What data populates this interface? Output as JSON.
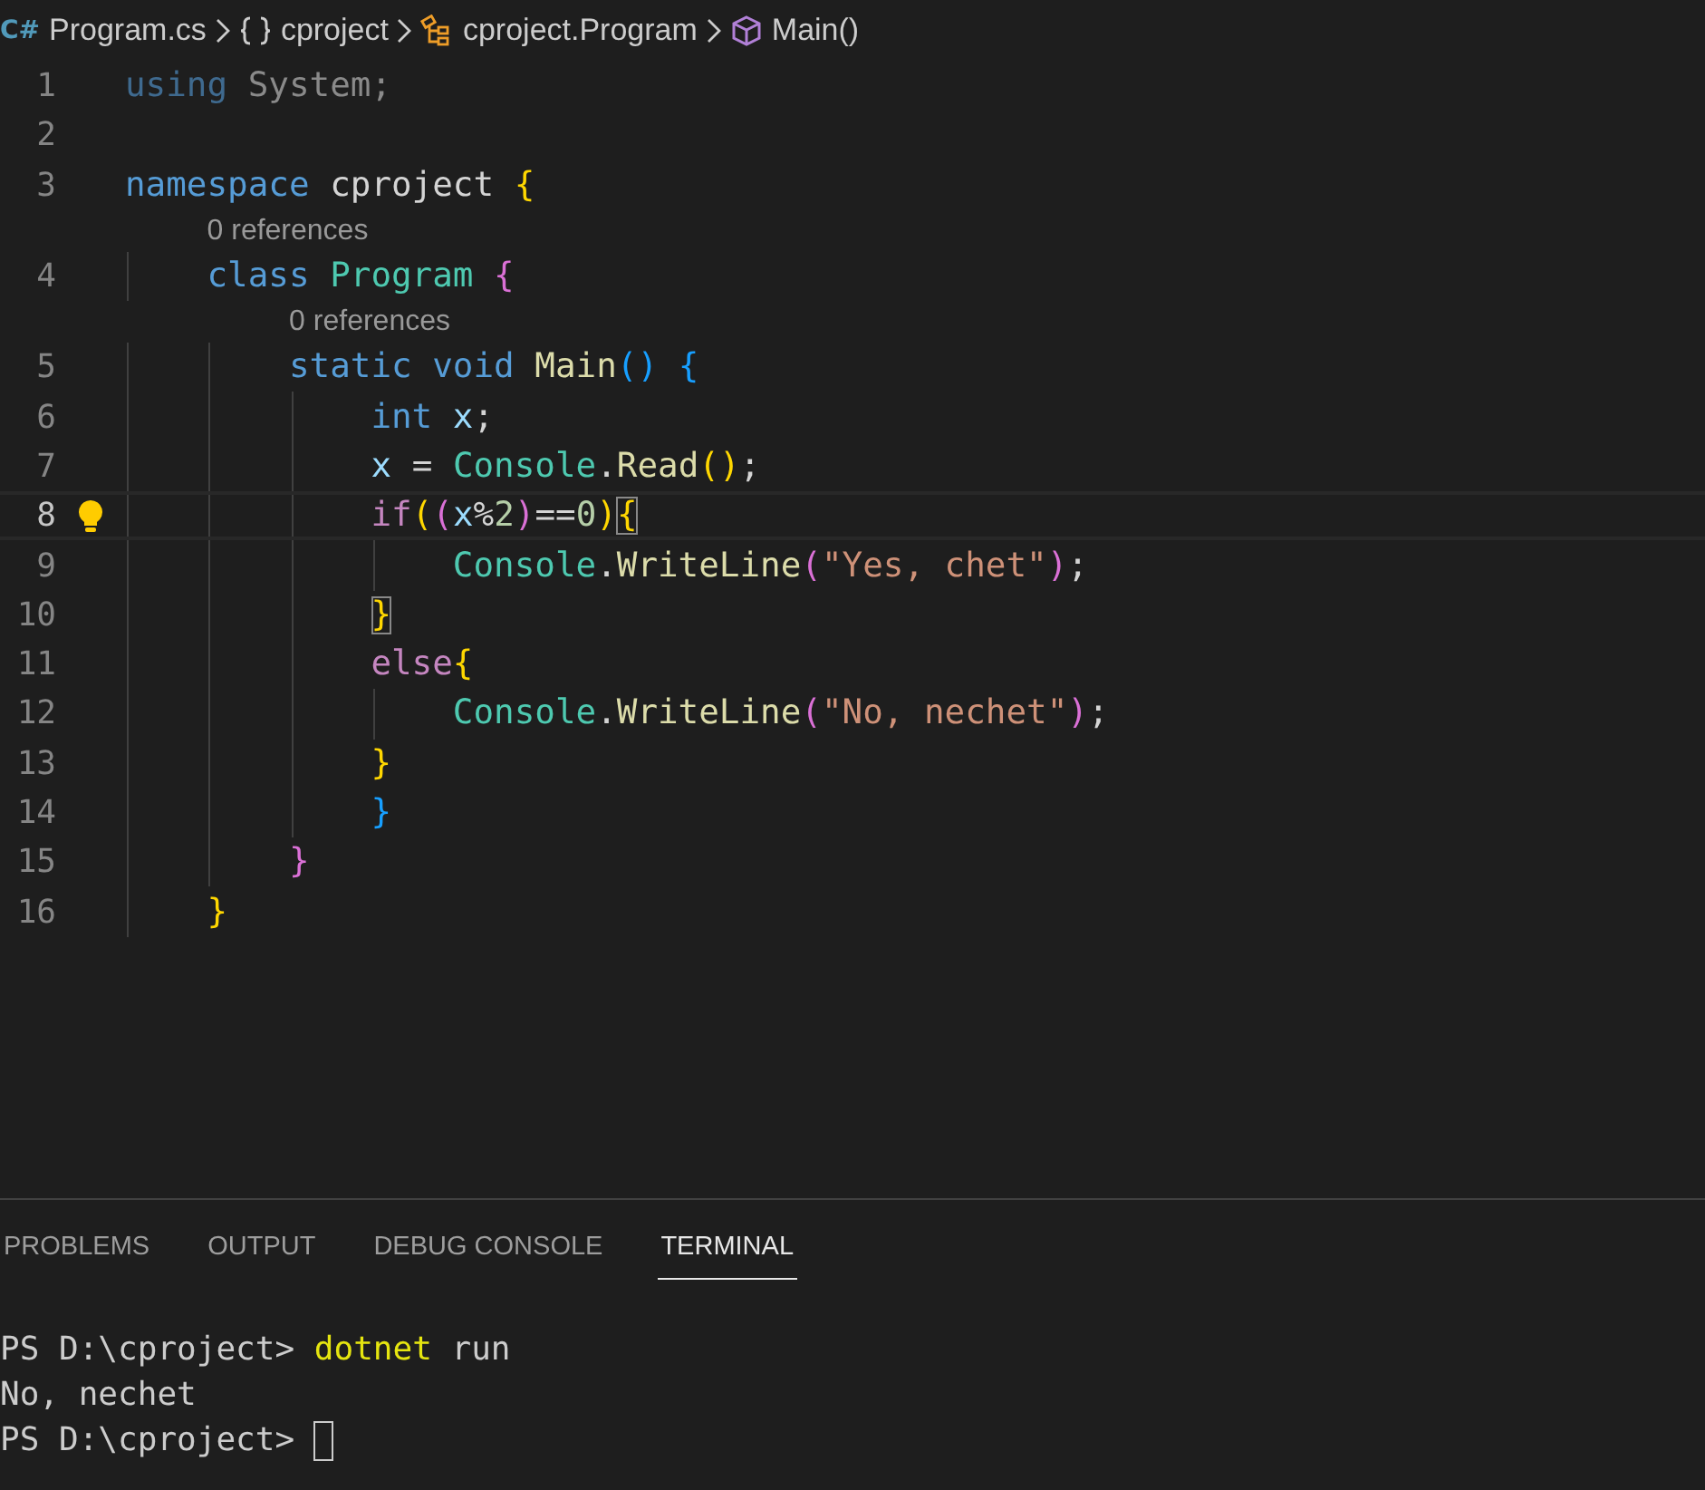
{
  "breadcrumbs": [
    {
      "kind": "file",
      "icon": "C#",
      "label": "Program.cs"
    },
    {
      "kind": "namespace",
      "label": "cproject"
    },
    {
      "kind": "class",
      "label": "cproject.Program"
    },
    {
      "kind": "method",
      "label": "Main()"
    }
  ],
  "editor": {
    "lines": [
      {
        "number": "1",
        "current": false,
        "lightbulb": false,
        "tokens": [
          {
            "kind": "dimkeyword",
            "text": "using"
          },
          {
            "kind": "dim",
            "text": " System;"
          }
        ]
      },
      {
        "number": "2",
        "current": false,
        "lightbulb": false
      },
      {
        "number": "3",
        "current": false,
        "lightbulb": false,
        "tokens": [
          {
            "kind": "keyword",
            "text": "namespace"
          },
          {
            "kind": "plain",
            "text": " cproject "
          },
          {
            "kind": "bracket1",
            "text": "{"
          }
        ]
      },
      {
        "number": "4",
        "current": false,
        "lightbulb": false,
        "codelens": "0 references",
        "tokens": [
          {
            "kind": "keyword",
            "text": "    class "
          },
          {
            "kind": "type",
            "text": "Program "
          },
          {
            "kind": "bracket2",
            "text": "{"
          }
        ]
      },
      {
        "number": "5",
        "current": false,
        "lightbulb": false,
        "codelens": "0 references",
        "tokens": [
          {
            "kind": "keyword",
            "text": "        static "
          },
          {
            "kind": "keyword",
            "text": "void "
          },
          {
            "kind": "func",
            "text": "Main"
          },
          {
            "kind": "bracket3",
            "text": "()"
          },
          {
            "kind": "bracket3",
            "text": " {"
          }
        ]
      },
      {
        "number": "6",
        "current": false,
        "lightbulb": false,
        "tokens": [
          {
            "kind": "keyword",
            "text": "            int "
          },
          {
            "kind": "variable",
            "text": "x"
          },
          {
            "kind": "plain",
            "text": ";"
          }
        ]
      },
      {
        "number": "7",
        "current": false,
        "lightbulb": false,
        "tokens": [
          {
            "kind": "variable",
            "text": "            x"
          },
          {
            "kind": "plain",
            "text": " = "
          },
          {
            "kind": "type",
            "text": "Console"
          },
          {
            "kind": "plain",
            "text": "."
          },
          {
            "kind": "func",
            "text": "Read"
          },
          {
            "kind": "bracket1",
            "text": "()"
          },
          {
            "kind": "plain",
            "text": ";"
          }
        ]
      },
      {
        "number": "8",
        "current": true,
        "lightbulb": true,
        "tokens": [
          {
            "kind": "control",
            "text": "            if"
          },
          {
            "kind": "bracket1",
            "text": "("
          },
          {
            "kind": "bracket2",
            "text": "("
          },
          {
            "kind": "variable",
            "text": "x"
          },
          {
            "kind": "plain",
            "text": "%"
          },
          {
            "kind": "number",
            "text": "2"
          },
          {
            "kind": "bracket2",
            "text": ")"
          },
          {
            "kind": "plain",
            "text": "=="
          },
          {
            "kind": "number",
            "text": "0"
          },
          {
            "kind": "bracket1",
            "text": ")"
          },
          {
            "kind": "matchbrace",
            "text": "{"
          }
        ]
      },
      {
        "number": "9",
        "current": false,
        "lightbulb": false,
        "tokens": [
          {
            "kind": "type",
            "text": "                Console"
          },
          {
            "kind": "plain",
            "text": "."
          },
          {
            "kind": "func",
            "text": "WriteLine"
          },
          {
            "kind": "bracket2",
            "text": "("
          },
          {
            "kind": "string",
            "text": "\"Yes, chet\""
          },
          {
            "kind": "bracket2",
            "text": ")"
          },
          {
            "kind": "plain",
            "text": ";"
          }
        ]
      },
      {
        "number": "10",
        "current": false,
        "lightbulb": false,
        "tokens": [
          {
            "kind": "matchbrace",
            "text": "            }"
          }
        ]
      },
      {
        "number": "11",
        "current": false,
        "lightbulb": false,
        "tokens": [
          {
            "kind": "control",
            "text": "            else"
          },
          {
            "kind": "bracket1",
            "text": "{"
          }
        ]
      },
      {
        "number": "12",
        "current": false,
        "lightbulb": false,
        "tokens": [
          {
            "kind": "type",
            "text": "                Console"
          },
          {
            "kind": "plain",
            "text": "."
          },
          {
            "kind": "func",
            "text": "WriteLine"
          },
          {
            "kind": "bracket2",
            "text": "("
          },
          {
            "kind": "string",
            "text": "\"No, nechet\""
          },
          {
            "kind": "bracket2",
            "text": ")"
          },
          {
            "kind": "plain",
            "text": ";"
          }
        ]
      },
      {
        "number": "13",
        "current": false,
        "lightbulb": false,
        "tokens": [
          {
            "kind": "bracket1",
            "text": "            }"
          }
        ]
      },
      {
        "number": "14",
        "current": false,
        "lightbulb": false,
        "tokens": [
          {
            "kind": "bracket3",
            "text": "            }"
          }
        ]
      },
      {
        "number": "15",
        "current": false,
        "lightbulb": false,
        "tokens": [
          {
            "kind": "bracket2",
            "text": "        }"
          }
        ]
      },
      {
        "number": "16",
        "current": false,
        "lightbulb": false,
        "tokens": [
          {
            "kind": "bracket1",
            "text": "    }"
          }
        ]
      }
    ]
  },
  "panel": {
    "tabs": [
      {
        "label": "PROBLEMS",
        "selected": false
      },
      {
        "label": "OUTPUT",
        "selected": false
      },
      {
        "label": "DEBUG CONSOLE",
        "selected": false
      },
      {
        "label": "TERMINAL",
        "selected": true
      }
    ],
    "terminal": [
      {
        "cursor": false,
        "tokens": [
          {
            "kind": "prompt",
            "text": "PS D:\\cproject> "
          },
          {
            "kind": "command",
            "text": "dotnet"
          },
          {
            "kind": "prompt",
            "text": " run"
          }
        ]
      },
      {
        "cursor": false,
        "tokens": [
          {
            "kind": "prompt",
            "text": "No, nechet"
          }
        ]
      },
      {
        "cursor": true,
        "tokens": [
          {
            "kind": "prompt",
            "text": "PS D:\\cproject> "
          }
        ]
      }
    ]
  }
}
